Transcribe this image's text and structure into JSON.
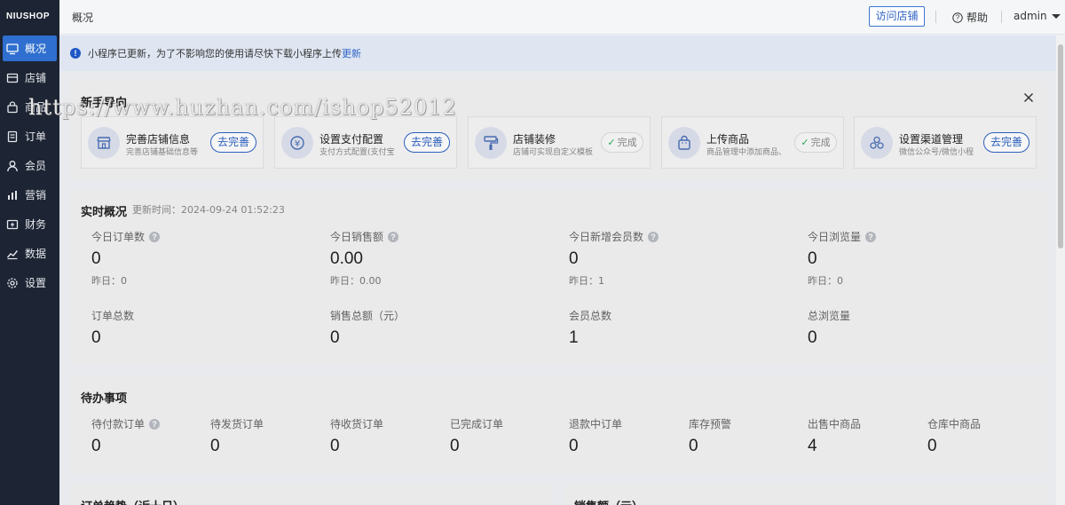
{
  "sidebar": {
    "logo": "NIUSHOP",
    "items": [
      {
        "label": "概况",
        "icon": "monitor-icon"
      },
      {
        "label": "店铺",
        "icon": "store-icon"
      },
      {
        "label": "商品",
        "icon": "bag-icon"
      },
      {
        "label": "订单",
        "icon": "document-icon"
      },
      {
        "label": "会员",
        "icon": "user-icon"
      },
      {
        "label": "营销",
        "icon": "bar-chart-icon"
      },
      {
        "label": "财务",
        "icon": "wallet-icon"
      },
      {
        "label": "数据",
        "icon": "trend-icon"
      },
      {
        "label": "设置",
        "icon": "gear-icon"
      }
    ],
    "active_index": 0
  },
  "header": {
    "title": "概况",
    "visit_store": "访问店铺",
    "help": "帮助",
    "user": "admin"
  },
  "notice": {
    "text": "小程序已更新，为了不影响您的使用请尽快下载小程序上传",
    "link": "更新"
  },
  "guide": {
    "title": "新手导向",
    "steps": [
      {
        "name": "完善店铺信息",
        "desc": "完善店铺基础信息等",
        "button": "去完善",
        "status": "go",
        "icon": "store-icon"
      },
      {
        "name": "设置支付配置",
        "desc": "支付方式配置(支付宝",
        "button": "去完善",
        "status": "go",
        "icon": "yuan-icon"
      },
      {
        "name": "店铺装修",
        "desc": "店铺可实现自定义模板",
        "button": "完成",
        "status": "done",
        "icon": "paint-roller-icon"
      },
      {
        "name": "上传商品",
        "desc": "商品管理中添加商品、",
        "button": "完成",
        "status": "done",
        "icon": "shopping-bag-icon"
      },
      {
        "name": "设置渠道管理",
        "desc": "微信公众号/微信小程",
        "button": "去完善",
        "status": "go",
        "icon": "channels-icon"
      }
    ]
  },
  "realtime": {
    "title": "实时概况",
    "update_time": "更新时间：2024-09-24 01:52:23",
    "today": [
      {
        "label": "今日订单数",
        "value": "0",
        "yesterday": "昨日：0"
      },
      {
        "label": "今日销售额",
        "value": "0.00",
        "yesterday": "昨日：0.00"
      },
      {
        "label": "今日新增会员数",
        "value": "0",
        "yesterday": "昨日：1"
      },
      {
        "label": "今日浏览量",
        "value": "0",
        "yesterday": "昨日：0"
      }
    ],
    "totals": [
      {
        "label": "订单总数",
        "value": "0"
      },
      {
        "label": "销售总额（元）",
        "value": "0"
      },
      {
        "label": "会员总数",
        "value": "1"
      },
      {
        "label": "总浏览量",
        "value": "0"
      }
    ]
  },
  "todo": {
    "title": "待办事项",
    "items": [
      {
        "label": "待付款订单",
        "value": "0",
        "help": true
      },
      {
        "label": "待发货订单",
        "value": "0"
      },
      {
        "label": "待收货订单",
        "value": "0"
      },
      {
        "label": "已完成订单",
        "value": "0"
      },
      {
        "label": "退款中订单",
        "value": "0"
      },
      {
        "label": "库存预警",
        "value": "0"
      },
      {
        "label": "出售中商品",
        "value": "4"
      },
      {
        "label": "仓库中商品",
        "value": "0"
      }
    ]
  },
  "bottom": {
    "left_title": "订单趋势（近十日）",
    "right_title": "销售额（元）"
  },
  "watermark": "https://www.huzhan.com/ishop52012",
  "colors": {
    "accent": "#2e63c2",
    "sidebar_bg": "#1d2433",
    "active_bg": "#2f6fcf",
    "done_check": "#2bab5a"
  }
}
